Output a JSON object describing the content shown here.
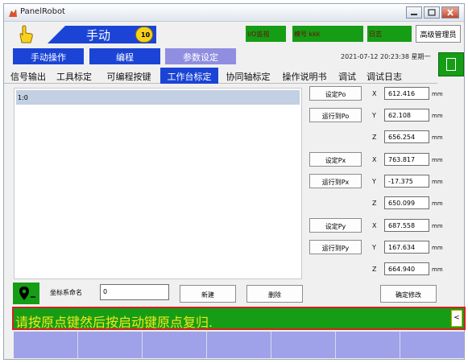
{
  "window": {
    "title": "PanelRobot"
  },
  "header": {
    "mode_title": "手动",
    "speed_value": "10",
    "io_monitor": "I/O监视",
    "module_label": "模号 kkk",
    "status_label": "日志",
    "user_button": "高级管理员"
  },
  "main_tabs": [
    {
      "label": "手动操作",
      "color": "#1b44d6"
    },
    {
      "label": "编程",
      "color": "#1b44d6"
    },
    {
      "label": "参数设定",
      "color": "#8f8ee0"
    }
  ],
  "datetime": "2021-07-12  20:23:38  星期一",
  "sub_tabs": [
    {
      "label": "信号输出",
      "active": false
    },
    {
      "label": "工具标定",
      "active": false
    },
    {
      "label": "可编程按键",
      "active": false
    },
    {
      "label": "工作台标定",
      "active": true
    },
    {
      "label": "协同轴标定",
      "active": false
    },
    {
      "label": "操作说明书",
      "active": false
    },
    {
      "label": "调试",
      "active": false
    },
    {
      "label": "调试日志",
      "active": false
    }
  ],
  "coord_list": {
    "selected_row": "1:0"
  },
  "calibration": {
    "buttons": [
      "设定Po",
      "运行到Po",
      "设定Px",
      "运行到Px",
      "设定Py",
      "运行到Py"
    ],
    "rows": [
      {
        "axis": "X",
        "value": "612.416",
        "unit": "mm"
      },
      {
        "axis": "Y",
        "value": "62.108",
        "unit": "mm"
      },
      {
        "axis": "Z",
        "value": "656.254",
        "unit": "mm"
      },
      {
        "axis": "X",
        "value": "763.817",
        "unit": "mm"
      },
      {
        "axis": "Y",
        "value": "-17.375",
        "unit": "mm"
      },
      {
        "axis": "Z",
        "value": "650.099",
        "unit": "mm"
      },
      {
        "axis": "X",
        "value": "687.558",
        "unit": "mm"
      },
      {
        "axis": "Y",
        "value": "167.634",
        "unit": "mm"
      },
      {
        "axis": "Z",
        "value": "664.940",
        "unit": "mm"
      }
    ]
  },
  "bottom": {
    "coord_name_label": "坐标系命名",
    "coord_name_value": "0",
    "new_button": "新建",
    "delete_button": "删除",
    "confirm_button": "确定修改"
  },
  "status": {
    "message": "请按原点键然后按启动键原点复归.",
    "toggle": "<"
  },
  "colors": {
    "accent_blue": "#1b44d6",
    "status_green": "#169d16",
    "alert_red": "#d62020",
    "message_yellow": "#f5e61b",
    "footer_lilac": "#9fa2e8"
  }
}
